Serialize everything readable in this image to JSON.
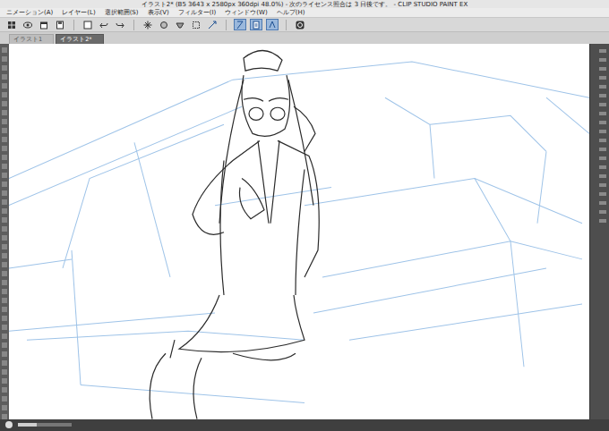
{
  "window": {
    "title": "イラスト2* (B5 3643 x 2580px 360dpi 48.0%)  - 次のライセンス照合は 3 日後です。 - CLIP STUDIO PAINT EX"
  },
  "menu": [
    "ニメーション(A)",
    "レイヤー(L)",
    "選択範囲(S)",
    "表示(V)",
    "フィルター(I)",
    "ウィンドウ(W)",
    "ヘルプ(H)"
  ],
  "toolbar": [
    {
      "selected": false
    },
    {
      "selected": false
    },
    {
      "selected": false
    },
    {
      "selected": false
    },
    {
      "selected": false
    },
    {
      "selected": false
    },
    {
      "selected": false
    },
    {
      "selected": false
    },
    {
      "selected": false
    },
    {
      "selected": false
    },
    {
      "selected": false
    },
    {
      "selected": false
    },
    {
      "selected": true
    },
    {
      "selected": true
    },
    {
      "selected": true
    },
    {
      "selected": false
    }
  ],
  "tabs": [
    {
      "label": "イラスト1",
      "selected": false
    },
    {
      "label": "イラスト2*",
      "selected": true
    }
  ],
  "zoom_slider": {
    "level": 0.35
  }
}
